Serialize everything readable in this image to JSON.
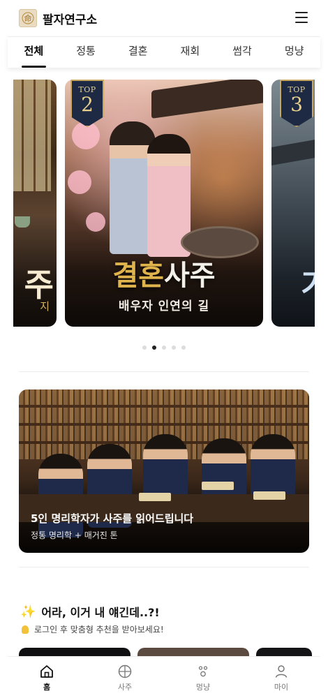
{
  "header": {
    "brand": "팔자연구소",
    "logo_char": "命",
    "logo_icon": "seal-logo-icon",
    "menu_icon": "hamburger-menu-icon"
  },
  "tabs": [
    {
      "label": "전체",
      "active": true
    },
    {
      "label": "정통",
      "active": false
    },
    {
      "label": "결혼",
      "active": false
    },
    {
      "label": "재회",
      "active": false
    },
    {
      "label": "썸각",
      "active": false
    },
    {
      "label": "멍냥",
      "active": false
    }
  ],
  "carousel": {
    "left_card": {
      "title": "주",
      "subtitle": "지"
    },
    "main_card": {
      "badge_top": "TOP",
      "badge_rank": "2",
      "title_highlight": "결혼",
      "title_rest": "사주",
      "subtitle": "배우자 인연의 길"
    },
    "right_card": {
      "badge_top": "TOP",
      "badge_rank": "3",
      "title": "기"
    },
    "dots": {
      "count": 5,
      "active_index": 1
    }
  },
  "banner": {
    "title": "5인 명리학자가 사주를 읽어드립니다",
    "subtitle": "정통 명리학 + 매거진 톤"
  },
  "section": {
    "icon": "sparkle-icon",
    "title": "어라, 이거 내 얘긴데..?!",
    "hint_icon": "lightbulb-icon",
    "hint": "로그인 후 맞춤형 추천을 받아보세요!"
  },
  "bottom_nav": [
    {
      "label": "홈",
      "icon": "home-icon",
      "active": true
    },
    {
      "label": "사주",
      "icon": "compass-icon",
      "active": false
    },
    {
      "label": "멍냥",
      "icon": "paw-icon",
      "active": false
    },
    {
      "label": "마이",
      "icon": "user-icon",
      "active": false
    }
  ],
  "colors": {
    "accent_gold": "#e0b44c",
    "badge_navy": "#1e2a44",
    "text_dark": "#111111"
  }
}
